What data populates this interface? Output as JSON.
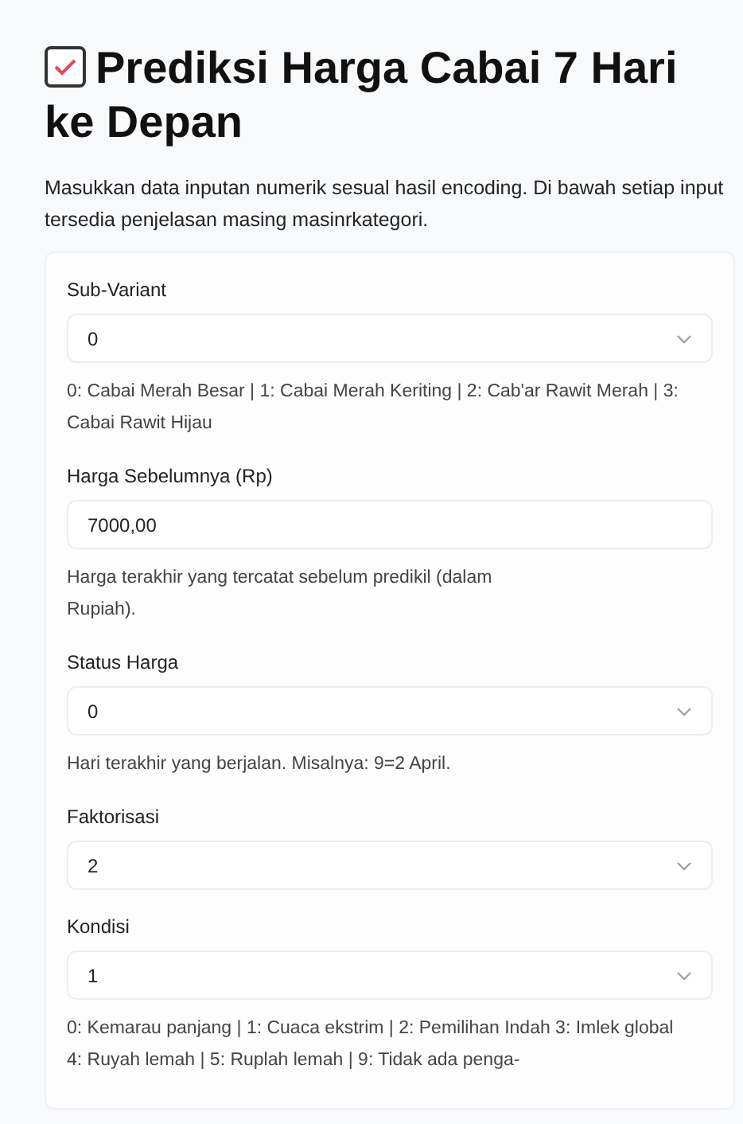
{
  "title": "Prediksi Harga Cabai 7 Hari ke Depan",
  "description": "Masukkan data inputan numerik sesual hasil encoding. Di bawah setiap input tersedia penjelasan masing masinrkategori.",
  "fields": [
    {
      "kind": "select",
      "label": "Sub-Variant",
      "value": "0",
      "hint_lines": [
        "0: Cabai Merah Besar | 1: Cabai Merah Keriting | 2: Cab'ar Rawit Merah | 3:",
        "Cabai Rawit Hijau"
      ]
    },
    {
      "kind": "number",
      "label": "Harga Sebelumnya (Rp)",
      "value": "7000,00",
      "hint_lines": [
        "Harga terakhir yang tercatat sebelum predikil (dalam",
        "Rupiah)."
      ]
    },
    {
      "kind": "select",
      "label": "Status Harga",
      "value": "0",
      "hint_lines": [
        "Hari terakhir yang berjalan. Misalnya: 9=2 April."
      ]
    },
    {
      "kind": "select",
      "label": "Faktorisasi",
      "value": "2"
    },
    {
      "kind": "select",
      "label": "Kondisi",
      "value": "1",
      "hint_lines": [
        "0: Kemarau panjang | 1: Cuaca ekstrim | 2: Pemilihan Indah  3: Imlek global",
        "4: Ruyah lemah | 5: Ruplah lemah | 9: Tidak ada penga-"
      ]
    }
  ]
}
